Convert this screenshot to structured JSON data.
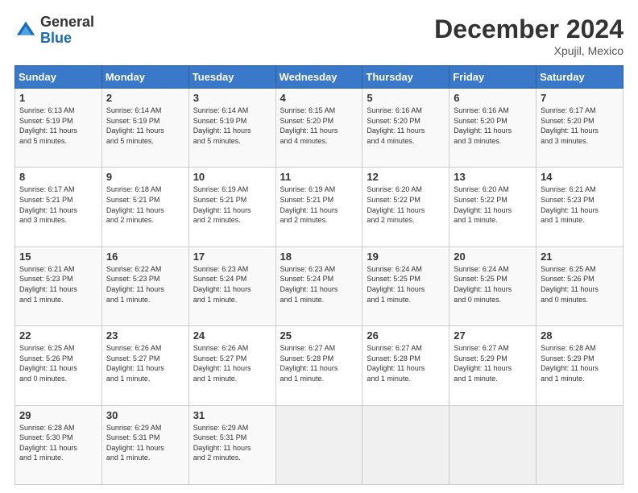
{
  "logo": {
    "general": "General",
    "blue": "Blue"
  },
  "title": "December 2024",
  "subtitle": "Xpujil, Mexico",
  "days_header": [
    "Sunday",
    "Monday",
    "Tuesday",
    "Wednesday",
    "Thursday",
    "Friday",
    "Saturday"
  ],
  "weeks": [
    [
      {
        "day": "1",
        "sunrise": "6:13 AM",
        "sunset": "5:19 PM",
        "daylight": "11 hours and 5 minutes."
      },
      {
        "day": "2",
        "sunrise": "6:14 AM",
        "sunset": "5:19 PM",
        "daylight": "11 hours and 5 minutes."
      },
      {
        "day": "3",
        "sunrise": "6:14 AM",
        "sunset": "5:19 PM",
        "daylight": "11 hours and 5 minutes."
      },
      {
        "day": "4",
        "sunrise": "6:15 AM",
        "sunset": "5:20 PM",
        "daylight": "11 hours and 4 minutes."
      },
      {
        "day": "5",
        "sunrise": "6:16 AM",
        "sunset": "5:20 PM",
        "daylight": "11 hours and 4 minutes."
      },
      {
        "day": "6",
        "sunrise": "6:16 AM",
        "sunset": "5:20 PM",
        "daylight": "11 hours and 3 minutes."
      },
      {
        "day": "7",
        "sunrise": "6:17 AM",
        "sunset": "5:20 PM",
        "daylight": "11 hours and 3 minutes."
      }
    ],
    [
      {
        "day": "8",
        "sunrise": "6:17 AM",
        "sunset": "5:21 PM",
        "daylight": "11 hours and 3 minutes."
      },
      {
        "day": "9",
        "sunrise": "6:18 AM",
        "sunset": "5:21 PM",
        "daylight": "11 hours and 2 minutes."
      },
      {
        "day": "10",
        "sunrise": "6:19 AM",
        "sunset": "5:21 PM",
        "daylight": "11 hours and 2 minutes."
      },
      {
        "day": "11",
        "sunrise": "6:19 AM",
        "sunset": "5:21 PM",
        "daylight": "11 hours and 2 minutes."
      },
      {
        "day": "12",
        "sunrise": "6:20 AM",
        "sunset": "5:22 PM",
        "daylight": "11 hours and 2 minutes."
      },
      {
        "day": "13",
        "sunrise": "6:20 AM",
        "sunset": "5:22 PM",
        "daylight": "11 hours and 1 minute."
      },
      {
        "day": "14",
        "sunrise": "6:21 AM",
        "sunset": "5:23 PM",
        "daylight": "11 hours and 1 minute."
      }
    ],
    [
      {
        "day": "15",
        "sunrise": "6:21 AM",
        "sunset": "5:23 PM",
        "daylight": "11 hours and 1 minute."
      },
      {
        "day": "16",
        "sunrise": "6:22 AM",
        "sunset": "5:23 PM",
        "daylight": "11 hours and 1 minute."
      },
      {
        "day": "17",
        "sunrise": "6:23 AM",
        "sunset": "5:24 PM",
        "daylight": "11 hours and 1 minute."
      },
      {
        "day": "18",
        "sunrise": "6:23 AM",
        "sunset": "5:24 PM",
        "daylight": "11 hours and 1 minute."
      },
      {
        "day": "19",
        "sunrise": "6:24 AM",
        "sunset": "5:25 PM",
        "daylight": "11 hours and 1 minute."
      },
      {
        "day": "20",
        "sunrise": "6:24 AM",
        "sunset": "5:25 PM",
        "daylight": "11 hours and 0 minutes."
      },
      {
        "day": "21",
        "sunrise": "6:25 AM",
        "sunset": "5:26 PM",
        "daylight": "11 hours and 0 minutes."
      }
    ],
    [
      {
        "day": "22",
        "sunrise": "6:25 AM",
        "sunset": "5:26 PM",
        "daylight": "11 hours and 0 minutes."
      },
      {
        "day": "23",
        "sunrise": "6:26 AM",
        "sunset": "5:27 PM",
        "daylight": "11 hours and 1 minute."
      },
      {
        "day": "24",
        "sunrise": "6:26 AM",
        "sunset": "5:27 PM",
        "daylight": "11 hours and 1 minute."
      },
      {
        "day": "25",
        "sunrise": "6:27 AM",
        "sunset": "5:28 PM",
        "daylight": "11 hours and 1 minute."
      },
      {
        "day": "26",
        "sunrise": "6:27 AM",
        "sunset": "5:28 PM",
        "daylight": "11 hours and 1 minute."
      },
      {
        "day": "27",
        "sunrise": "6:27 AM",
        "sunset": "5:29 PM",
        "daylight": "11 hours and 1 minute."
      },
      {
        "day": "28",
        "sunrise": "6:28 AM",
        "sunset": "5:29 PM",
        "daylight": "11 hours and 1 minute."
      }
    ],
    [
      {
        "day": "29",
        "sunrise": "6:28 AM",
        "sunset": "5:30 PM",
        "daylight": "11 hours and 1 minute."
      },
      {
        "day": "30",
        "sunrise": "6:29 AM",
        "sunset": "5:31 PM",
        "daylight": "11 hours and 1 minute."
      },
      {
        "day": "31",
        "sunrise": "6:29 AM",
        "sunset": "5:31 PM",
        "daylight": "11 hours and 2 minutes."
      },
      null,
      null,
      null,
      null
    ]
  ],
  "labels": {
    "sunrise": "Sunrise:",
    "sunset": "Sunset:",
    "daylight": "Daylight:"
  }
}
